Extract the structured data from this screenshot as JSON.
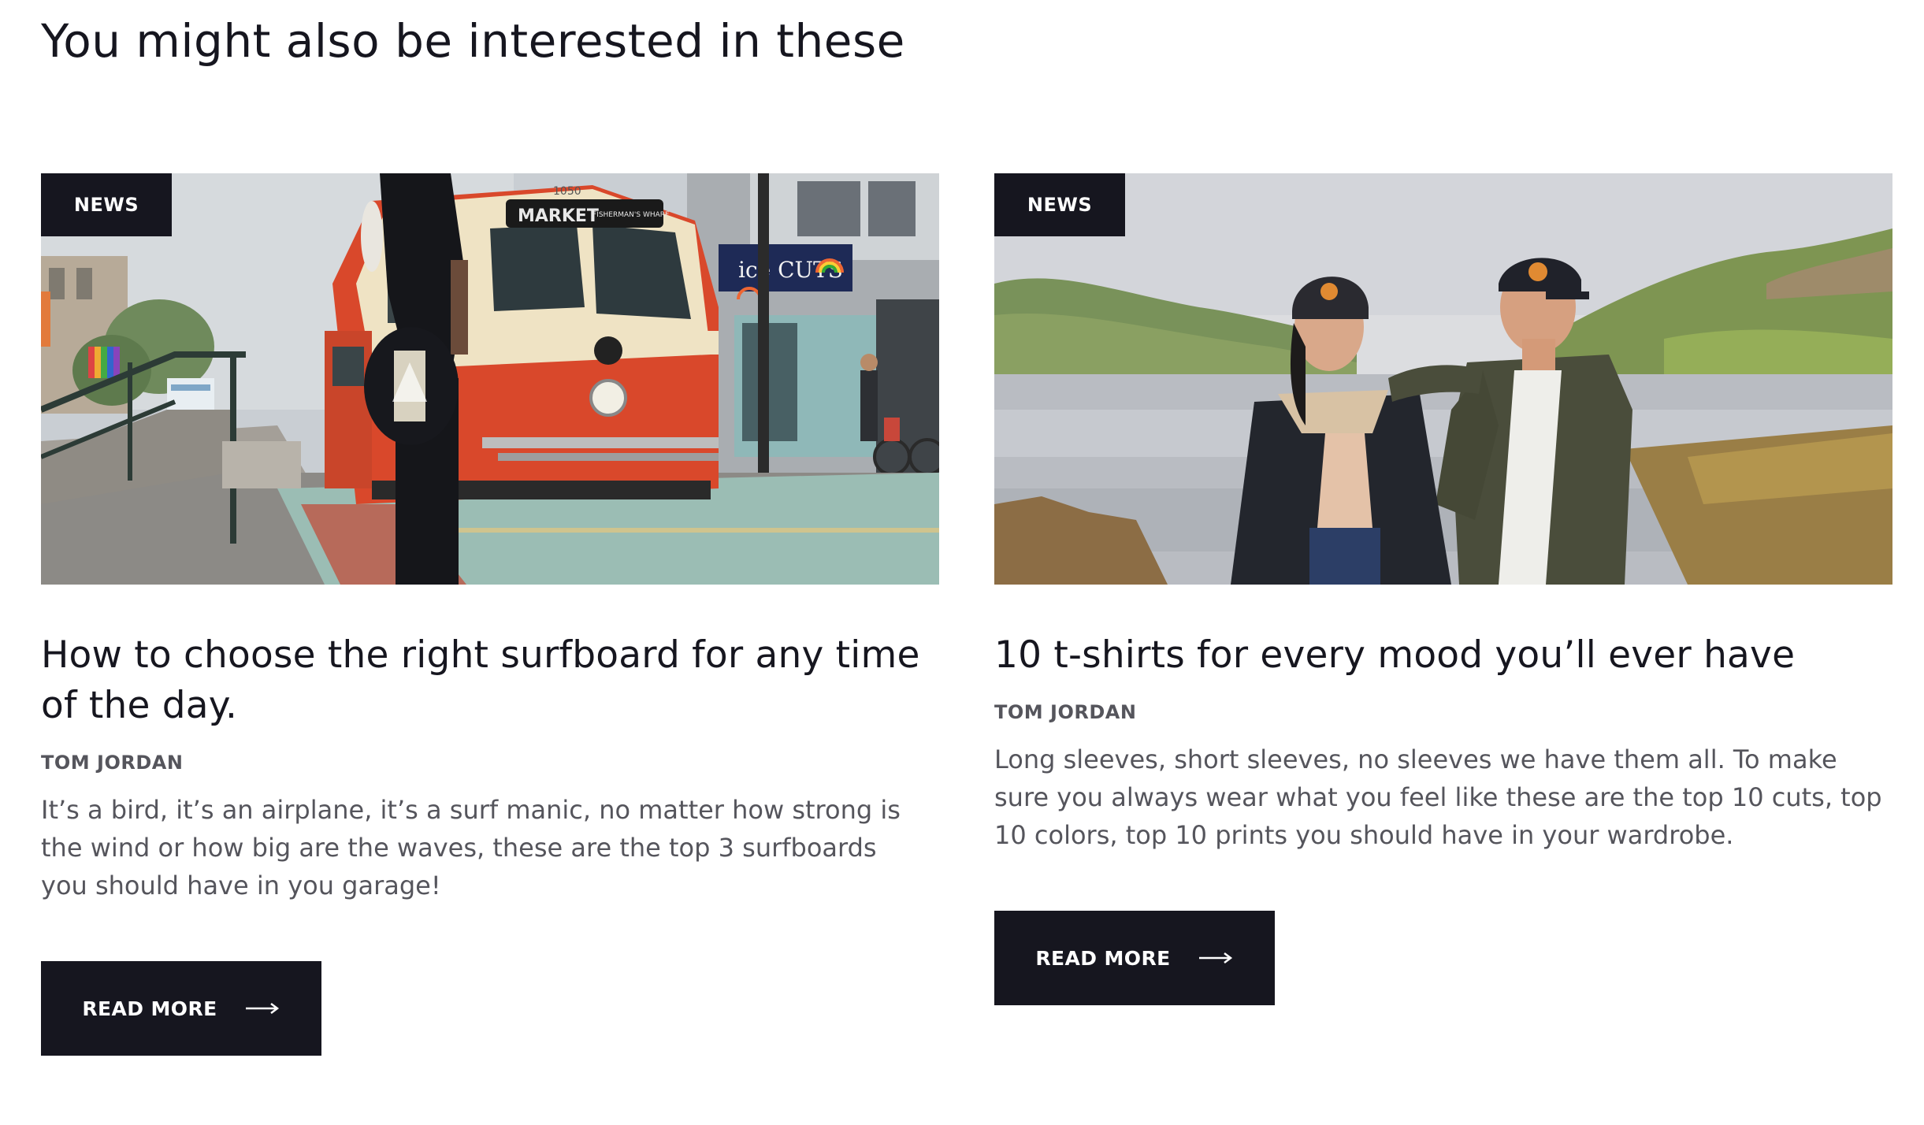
{
  "section": {
    "title": "You might also be interested in these"
  },
  "cards": [
    {
      "badge": "NEWS",
      "title": "How to choose the right surfboard for any time of the day.",
      "author": "TOM JORDAN",
      "excerpt": "It’s a bird, it’s an airplane, it’s a surf manic, no matter how strong is the wind or how big are the waves, these are the top 3 surfboards you should have in you garage!",
      "button_label": "READ MORE",
      "image": {
        "sign_market": "MARKET",
        "sign_number": "1050",
        "sign_wharf": "FISHERMAN'S WHARF",
        "sign_shop": "ice CUTS"
      }
    },
    {
      "badge": "NEWS",
      "title": "10 t-shirts for every mood you’ll ever have",
      "author": "TOM JORDAN",
      "excerpt": "Long sleeves, short sleeves, no sleeves we have them all. To make sure you always wear what you feel like these are the top 10 cuts, top 10 colors, top 10 prints you should have in your wardrobe.",
      "button_label": "READ MORE"
    }
  ],
  "colors": {
    "dark": "#16161f",
    "text_muted": "#55555c",
    "tram_red": "#d9482b",
    "tram_cream": "#efe3c4"
  }
}
